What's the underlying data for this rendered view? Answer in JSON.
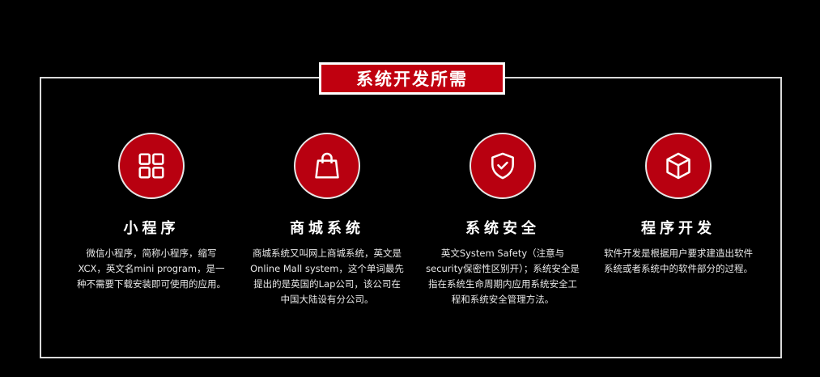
{
  "title": "系统开发所需",
  "cards": [
    {
      "icon": "grid-icon",
      "title": "小程序",
      "desc": "微信小程序，简称小程序，缩写XCX，英文名mini program，是一种不需要下载安装即可使用的应用。"
    },
    {
      "icon": "shopping-bag-icon",
      "title": "商城系统",
      "desc": "商城系统又叫网上商城系统，英文是Online Mall system，这个单词最先提出的是英国的Lap公司，该公司在中国大陆设有分公司。"
    },
    {
      "icon": "shield-check-icon",
      "title": "系统安全",
      "desc": "英文System Safety（注意与security保密性区别开）；系统安全是指在系统生命周期内应用系统安全工程和系统安全管理方法。"
    },
    {
      "icon": "cube-icon",
      "title": "程序开发",
      "desc": "软件开发是根据用户要求建造出软件系统或者系统中的软件部分的过程。"
    }
  ],
  "colors": {
    "accent": "#c0000f",
    "background": "#000000",
    "frame": "#d9d9d9"
  }
}
